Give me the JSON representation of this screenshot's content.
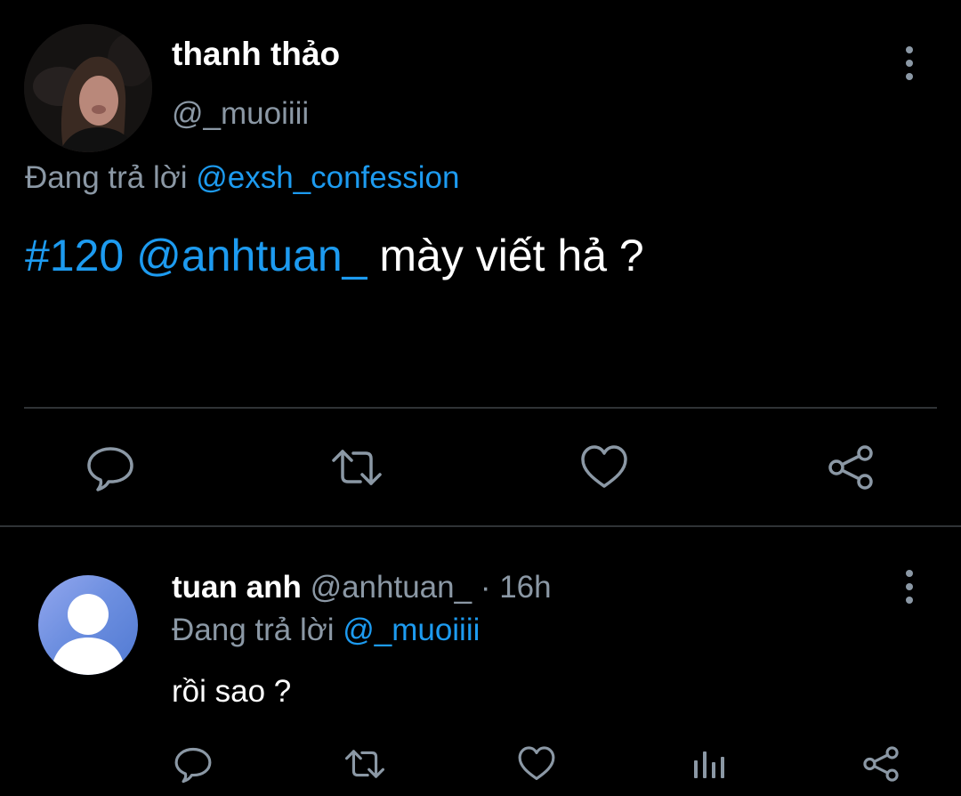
{
  "main_tweet": {
    "display_name": "thanh thảo",
    "handle": "@_muoiiii",
    "replying_prefix": "Đang trả lời",
    "replying_to": "@exsh_confession",
    "hashtag": "#120",
    "mention": "@anhtuan_",
    "body": "mày viết hả ?"
  },
  "reply_tweet": {
    "display_name": "tuan anh",
    "handle": "@anhtuan_",
    "separator": "·",
    "time": "16h",
    "replying_prefix": "Đang trả lời",
    "replying_to": "@_muoiiii",
    "body": "rồi sao ?"
  },
  "icons": {
    "reply": "reply-icon",
    "retweet": "retweet-icon",
    "like": "heart-icon",
    "share": "share-icon",
    "analytics": "analytics-icon",
    "more": "more-vertical-icon"
  },
  "colors": {
    "background": "#000000",
    "text": "#ffffff",
    "muted": "#8b98a5",
    "link": "#1d9bf0",
    "divider": "#2f3336"
  }
}
